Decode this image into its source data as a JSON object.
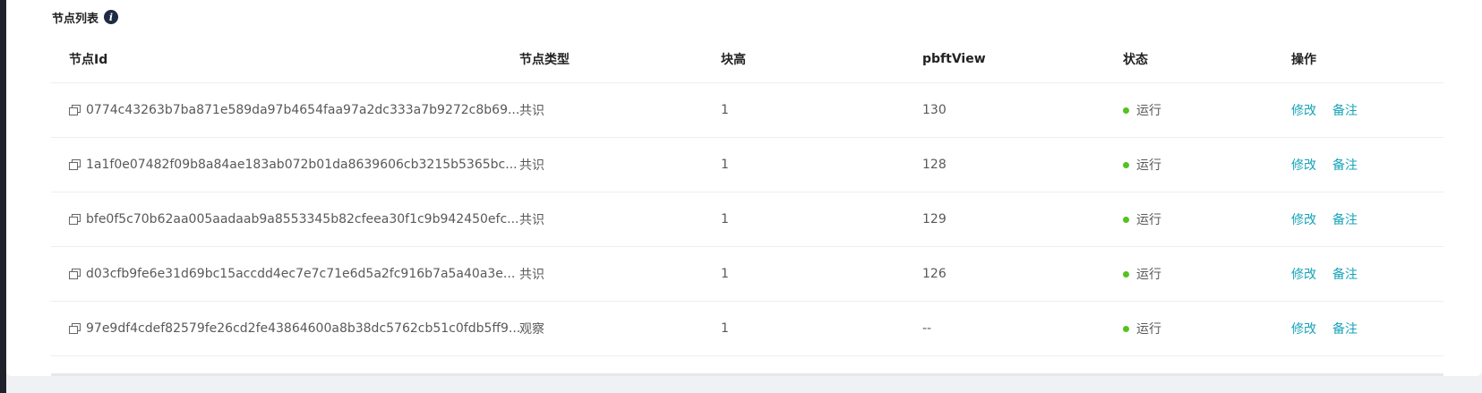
{
  "section": {
    "title": "节点列表",
    "info_icon": "i"
  },
  "columns": [
    "节点Id",
    "节点类型",
    "块高",
    "pbftView",
    "状态",
    "操作"
  ],
  "rows": [
    {
      "id": "0774c43263b7ba871e589da97b4654faa97a2dc333a7b9272c8b69...",
      "type": "共识",
      "height": "1",
      "view": "130",
      "status": "运行",
      "edit": "修改",
      "note": "备注"
    },
    {
      "id": "1a1f0e07482f09b8a84ae183ab072b01da8639606cb3215b5365bc...",
      "type": "共识",
      "height": "1",
      "view": "128",
      "status": "运行",
      "edit": "修改",
      "note": "备注"
    },
    {
      "id": "bfe0f5c70b62aa005aadaab9a8553345b82cfeea30f1c9b942450efc...",
      "type": "共识",
      "height": "1",
      "view": "129",
      "status": "运行",
      "edit": "修改",
      "note": "备注"
    },
    {
      "id": "d03cfb9fe6e31d69bc15accdd4ec7e7c71e6d5a2fc916b7a5a40a3e...",
      "type": "共识",
      "height": "1",
      "view": "126",
      "status": "运行",
      "edit": "修改",
      "note": "备注"
    },
    {
      "id": "97e9df4cdef82579fe26cd2fe43864600a8b38dc5762cb51c0fdb5ff9...",
      "type": "观察",
      "height": "1",
      "view": "--",
      "status": "运行",
      "edit": "修改",
      "note": "备注"
    }
  ],
  "colors": {
    "link": "#16a3b8",
    "status_running": "#52c41a"
  }
}
